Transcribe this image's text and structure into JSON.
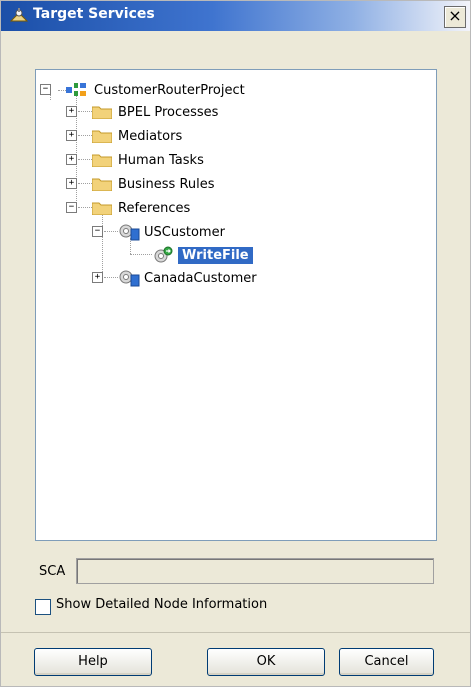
{
  "window": {
    "title": "Target Services",
    "close_symbol": "×"
  },
  "tree": {
    "root": "CustomerRouterProject",
    "items": [
      {
        "label": "BPEL Processes"
      },
      {
        "label": "Mediators"
      },
      {
        "label": "Human Tasks"
      },
      {
        "label": "Business Rules"
      },
      {
        "label": "References"
      },
      {
        "label": "USCustomer"
      },
      {
        "label": "WriteFile"
      },
      {
        "label": "CanadaCustomer"
      }
    ],
    "selected": "WriteFile"
  },
  "sca": {
    "label": "SCA",
    "value": ""
  },
  "options": {
    "show_detailed_label": "Show Detailed Node Information",
    "show_detailed_checked": false
  },
  "buttons": {
    "help": "Help",
    "ok": "OK",
    "cancel": "Cancel"
  },
  "colors": {
    "selection": "#316ac5",
    "titlebar": "#1b4fa8",
    "folder": "#f2d27a"
  }
}
